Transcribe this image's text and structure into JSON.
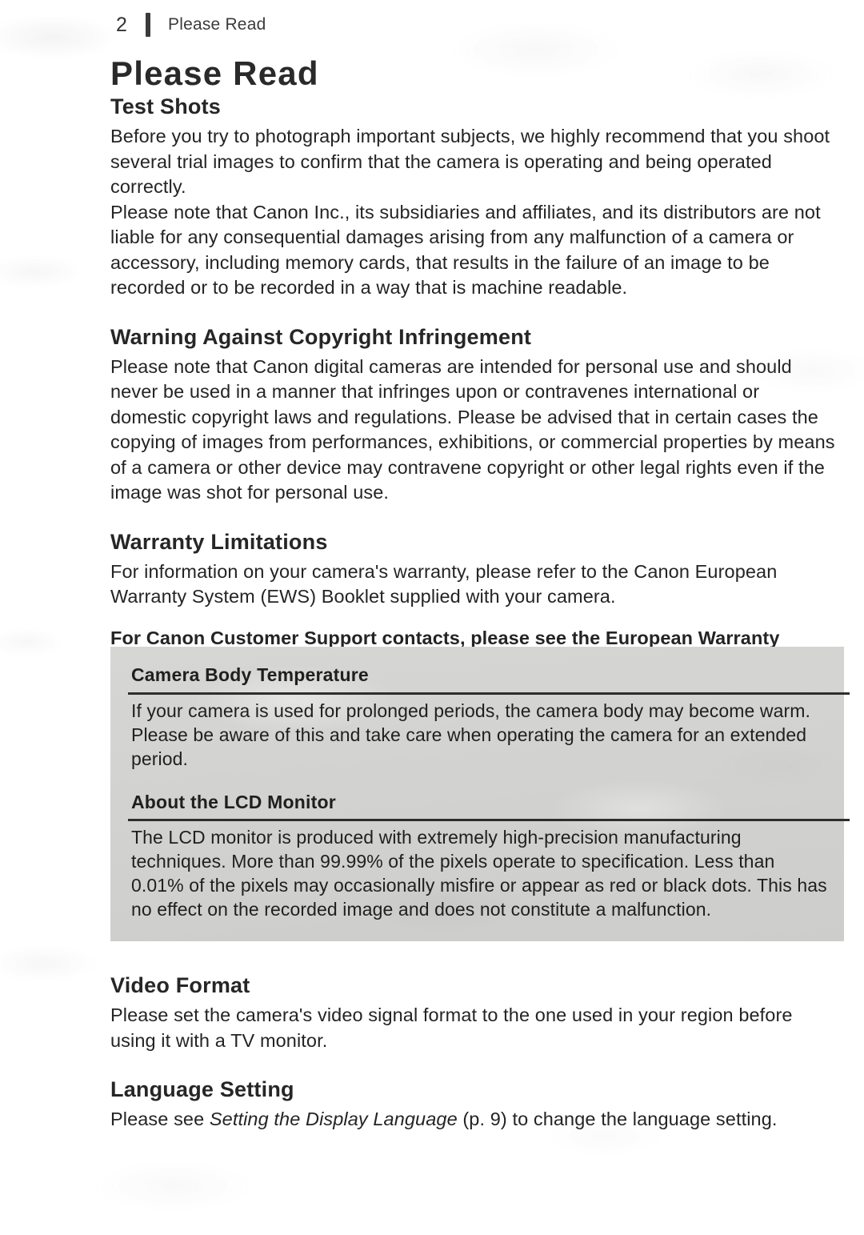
{
  "header": {
    "page_number": "2",
    "running_title": "Please Read"
  },
  "title": "Please Read",
  "sections": {
    "test_shots": {
      "heading": "Test Shots",
      "paragraph_1": "Before you try to photograph important subjects, we highly recommend that you shoot several trial images to confirm that the camera is operating and being operated correctly.",
      "paragraph_2": "Please note that Canon Inc., its subsidiaries and affiliates, and its distributors are not liable for any consequential damages arising from any malfunction of a camera or accessory, including memory cards, that results in the failure of an image to be recorded or to be recorded in a way that is machine readable."
    },
    "copyright": {
      "heading": "Warning Against Copyright Infringement",
      "paragraph": "Please note that Canon digital cameras are intended for personal use and should never be used in a manner that infringes upon or contravenes international or domestic copyright laws and regulations. Please be advised that in certain cases the copying of images from performances, exhibitions, or commercial properties by means of a camera or other device may contravene copyright or other legal rights even if the image was shot for personal use."
    },
    "warranty": {
      "heading": "Warranty Limitations",
      "paragraph": "For information on your camera's warranty, please refer to the Canon European Warranty System (EWS) Booklet supplied with your camera.",
      "paragraph_bold": "For Canon Customer Support contacts, please see the European Warranty System (EWS) Booklet."
    },
    "video_format": {
      "heading": "Video Format",
      "paragraph": "Please set the camera's video signal format to the one used in your region before using it with a TV monitor."
    },
    "language_setting": {
      "heading": "Language Setting",
      "text_before": "Please see ",
      "italic_reference": "Setting the Display Language",
      "text_after": " (p. 9) to change the language setting."
    }
  },
  "callout": {
    "temperature": {
      "heading": "Camera Body Temperature",
      "paragraph": "If your camera is used for prolonged periods, the camera body may become warm. Please be aware of this and take care when operating the camera for an extended period."
    },
    "lcd_monitor": {
      "heading": "About the LCD Monitor",
      "paragraph": "The LCD monitor is produced with extremely high-precision manufacturing techniques. More than 99.99% of the pixels operate to specification. Less than 0.01% of the pixels may occasionally misfire or appear as red or black dots. This has no effect on the recorded image and does not constitute a malfunction."
    }
  },
  "colors": {
    "page_background": "#ffffff",
    "text": "#242424",
    "callout_background": "#d2d2d0",
    "rule": "#2e2e2e"
  }
}
